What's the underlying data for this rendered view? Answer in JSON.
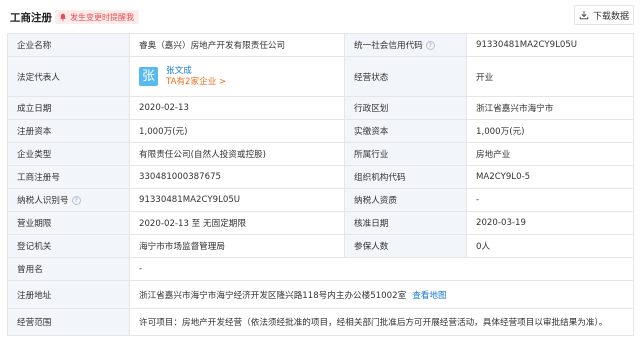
{
  "header": {
    "title": "工商注册",
    "notice": "发生变更时提醒我",
    "download": "下载数据"
  },
  "rows": [
    {
      "l1": "企业名称",
      "v1": "睿奥（嘉兴）房地产开发有限责任公司",
      "l2": "统一社会信用代码",
      "v2": "91330481MA2CY9L05U"
    },
    {
      "l1": "法定代表人",
      "v1": "",
      "l2": "经营状态",
      "v2": "开业"
    },
    {
      "l1": "成立日期",
      "v1": "2020-02-13",
      "l2": "行政区划",
      "v2": "浙江省嘉兴市海宁市"
    },
    {
      "l1": "注册资本",
      "v1": "1,000万(元)",
      "l2": "实缴资本",
      "v2": "1,000万(元)"
    },
    {
      "l1": "企业类型",
      "v1": "有限责任公司(自然人投资或控股)",
      "l2": "所属行业",
      "v2": "房地产业"
    },
    {
      "l1": "工商注册号",
      "v1": "330481000387675",
      "l2": "组织机构代码",
      "v2": "MA2CY9L0-5"
    },
    {
      "l1": "纳税人识别号",
      "v1": "91330481MA2CY9L05U",
      "l2": "纳税人资质",
      "v2": "-"
    },
    {
      "l1": "营业期限",
      "v1": "2020-02-13 至 无固定期限",
      "l2": "核准日期",
      "v2": "2020-03-19"
    },
    {
      "l1": "登记机关",
      "v1": "海宁市市场监督管理局",
      "l2": "参保人数",
      "v2": "0人"
    }
  ],
  "legal_rep": {
    "avatar": "张",
    "name": "张文成",
    "link": "TA有2家企业 >"
  },
  "used_name": {
    "label": "曾用名",
    "value": "-"
  },
  "address": {
    "label": "注册地址",
    "value": "浙江省嘉兴市海宁市海宁经济开发区隆兴路118号内主办公楼51002室",
    "link": "查看地图"
  },
  "scope": {
    "label": "经营范围",
    "value": "许可项目：房地产开发经营（依法须经批准的项目，经相关部门批准后方可开展经营活动，具体经营项目以审批结果为准）。"
  }
}
